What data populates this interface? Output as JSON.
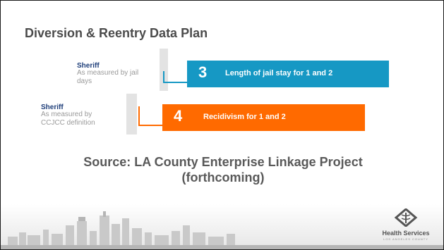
{
  "title": "Diversion & Reentry Data Plan",
  "rows": [
    {
      "org": "Sheriff",
      "measure_line1": "As measured by jail",
      "measure_line2": "days",
      "number": "3",
      "label": "Length of jail stay for 1 and 2",
      "color": "#1698c4"
    },
    {
      "org": "Sheriff",
      "measure_line1": "As measured by",
      "measure_line2": "CCJCC definition",
      "number": "4",
      "label": "Recidivism for 1 and 2",
      "color": "#ff6a00"
    }
  ],
  "source_line1": "Source: LA County Enterprise Linkage Project",
  "source_line2": "(forthcoming)",
  "logo": {
    "text": "Health Services",
    "sub": "LOS ANGELES COUNTY",
    "icon": "caduceus-icon"
  },
  "colors": {
    "title_text": "#4b4b4b",
    "org_text": "#1f3f7a",
    "skyline": "#c9c9c9"
  }
}
